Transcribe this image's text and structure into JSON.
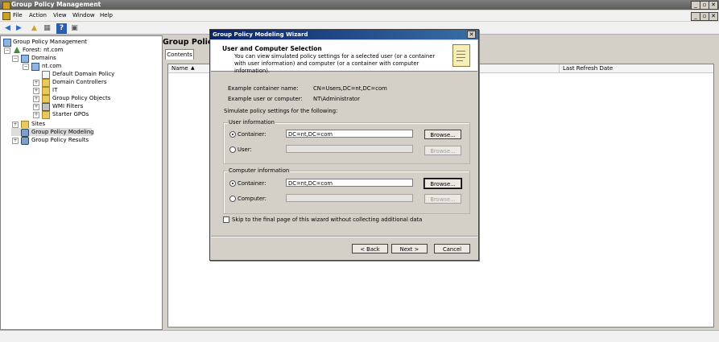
{
  "window": {
    "title": "Group Policy Management",
    "controls": [
      "_",
      "▫",
      "✕"
    ],
    "inner_controls": [
      "_",
      "▫",
      "✕"
    ]
  },
  "menu": [
    "File",
    "Action",
    "View",
    "Window",
    "Help"
  ],
  "toolbar_icons": [
    "back-icon",
    "forward-icon",
    "up-folder-icon",
    "properties-icon",
    "help-icon",
    "console-icon"
  ],
  "tree": {
    "root": "Group Policy Management",
    "forest": "Forest: nt.com",
    "domains": "Domains",
    "domain": "nt.com",
    "domain_children": [
      "Default Domain Policy",
      "Domain Controllers",
      "IT",
      "Group Policy Objects",
      "WMI Filters",
      "Starter GPOs"
    ],
    "sites": "Sites",
    "modeling": "Group Policy Modeling",
    "results": "Group Policy Results"
  },
  "right_pane": {
    "title": "Group Policy",
    "tab": "Contents",
    "columns": [
      "Name",
      "Last Refresh Date"
    ]
  },
  "dialog": {
    "title": "Group Policy Modeling Wizard",
    "close": "✕",
    "heading": "User and Computer Selection",
    "description": "You can view simulated policy settings for a selected user (or a container with user information) and computer (or a container with computer information).",
    "example_container_label": "Example container name:",
    "example_container_value": "CN=Users,DC=nt,DC=com",
    "example_user_label": "Example user or computer:",
    "example_user_value": "NT\\Administrator",
    "simulate_label": "Simulate policy settings for the following:",
    "user_group": {
      "title": "User information",
      "container_label": "Container:",
      "container_value": "DC=nt,DC=com",
      "user_label": "User:",
      "user_value": "",
      "browse": "Browse..."
    },
    "computer_group": {
      "title": "Computer information",
      "container_label": "Container:",
      "container_value": "DC=nt,DC=com",
      "computer_label": "Computer:",
      "computer_value": "",
      "browse": "Browse..."
    },
    "skip_label": "Skip to the final page of this wizard without collecting additional data",
    "back": "< Back",
    "next": "Next >",
    "cancel": "Cancel"
  }
}
